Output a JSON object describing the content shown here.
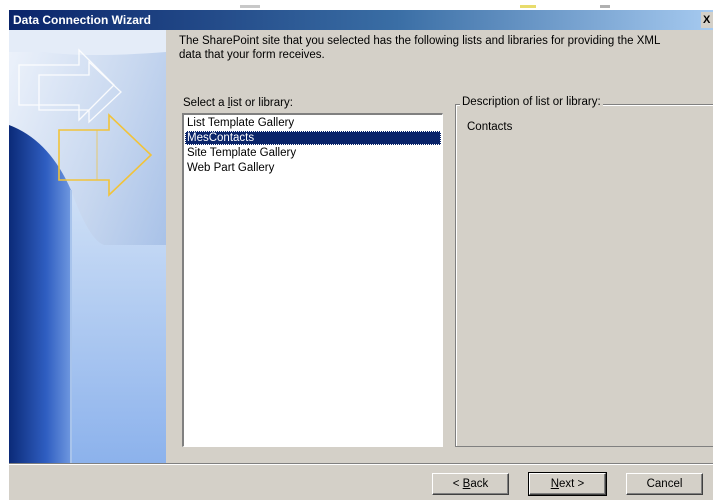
{
  "window": {
    "title": "Data Connection Wizard",
    "close_glyph": "X"
  },
  "intro_text": {
    "line1": "The SharePoint site that you selected has the following lists and libraries for providing the XML",
    "line2": "data that your form receives."
  },
  "list_section": {
    "label_pre": "Select a ",
    "label_accel": "l",
    "label_post": "ist or library:",
    "items": [
      {
        "label": "List Template Gallery",
        "selected": false
      },
      {
        "label": "MesContacts",
        "selected": true
      },
      {
        "label": "Site Template Gallery",
        "selected": false
      },
      {
        "label": "Web Part Gallery",
        "selected": false
      }
    ]
  },
  "description": {
    "label": "Description of list or library:",
    "text": "Contacts"
  },
  "buttons": {
    "back": {
      "pre": "< ",
      "accel": "B",
      "post": "ack"
    },
    "next": {
      "pre": "",
      "accel": "N",
      "post": "ext >"
    },
    "cancel": {
      "label": "Cancel"
    }
  },
  "colors": {
    "title_bar_start": "#0a246a",
    "title_bar_end": "#a6caf0",
    "dialog_face": "#d4d0c8",
    "selection": "#0a246a"
  },
  "icons": {
    "wizard_banner": "wizard-banner-graphic",
    "close": "close-icon"
  }
}
